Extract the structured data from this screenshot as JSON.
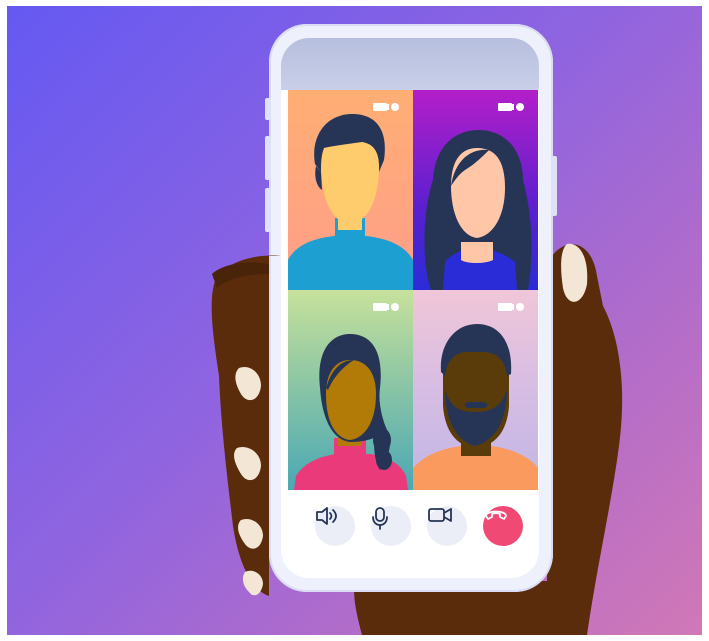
{
  "scene": "video-call-illustration",
  "colors": {
    "background_start": "#6559f2",
    "background_end": "#d178b6",
    "hand": "#5a2c0c",
    "nail": "#f4e6d4",
    "phone_frame": "#eef0fb",
    "end_call": "#f04a74"
  },
  "participants": [
    {
      "id": "participant-1",
      "tile_bg": "peach-gradient",
      "camera_on": true
    },
    {
      "id": "participant-2",
      "tile_bg": "purple-blue-gradient",
      "camera_on": true
    },
    {
      "id": "participant-3",
      "tile_bg": "green-teal-gradient",
      "camera_on": true
    },
    {
      "id": "participant-4",
      "tile_bg": "lavender-gradient",
      "camera_on": true
    }
  ],
  "call_controls": [
    {
      "id": "speaker",
      "icon": "speaker-icon"
    },
    {
      "id": "microphone",
      "icon": "microphone-icon"
    },
    {
      "id": "camera",
      "icon": "video-camera-icon"
    },
    {
      "id": "end-call",
      "icon": "hang-up-icon"
    }
  ]
}
